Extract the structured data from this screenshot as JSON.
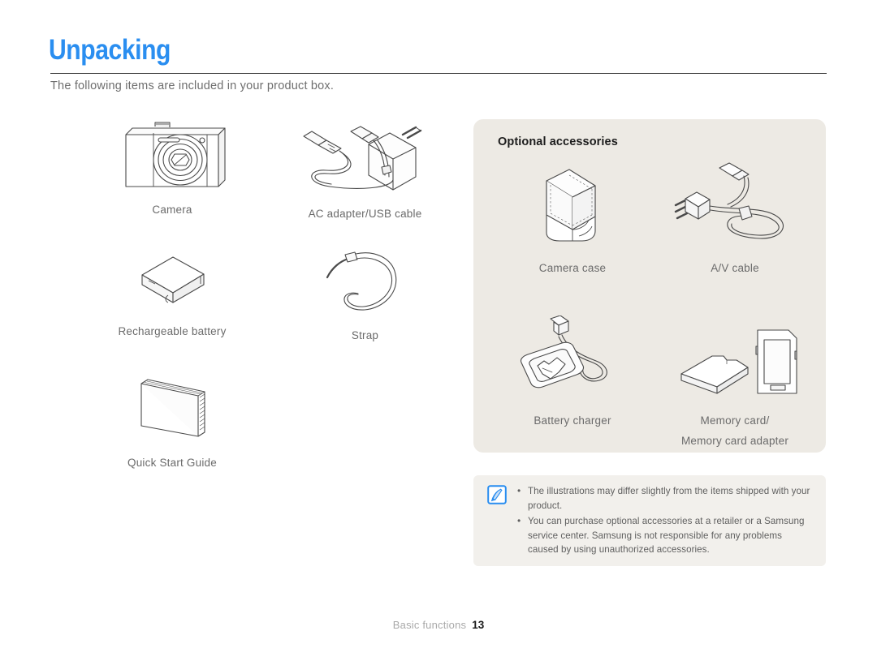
{
  "header": {
    "title": "Unpacking",
    "intro": "The following items are included in your product box.",
    "title_color": "#2a8ef0"
  },
  "included_items": [
    {
      "id": "camera",
      "caption": "Camera",
      "icon": "camera-illustration"
    },
    {
      "id": "ac-adapter",
      "caption": "AC adapter/USB cable",
      "icon": "ac-adapter-usb-cable-illustration"
    },
    {
      "id": "battery",
      "caption": "Rechargeable battery",
      "icon": "rechargeable-battery-illustration"
    },
    {
      "id": "strap",
      "caption": "Strap",
      "icon": "strap-illustration"
    },
    {
      "id": "quick-guide",
      "caption": "Quick Start Guide",
      "icon": "quick-start-guide-illustration"
    }
  ],
  "optional": {
    "title": "Optional accessories",
    "background": "#edeae4",
    "items": [
      {
        "id": "camera-case",
        "caption": "Camera case",
        "caption2": "",
        "icon": "camera-case-illustration"
      },
      {
        "id": "av-cable",
        "caption": "A/V cable",
        "caption2": "",
        "icon": "av-cable-illustration"
      },
      {
        "id": "battery-chg",
        "caption": "Battery charger",
        "caption2": "",
        "icon": "battery-charger-illustration"
      },
      {
        "id": "memory-card",
        "caption": "Memory card/",
        "caption2": "Memory card adapter",
        "icon": "memory-card-illustration"
      }
    ]
  },
  "note": {
    "icon": "note-pen-icon",
    "lines": [
      "The illustrations may differ slightly from the items shipped with your product.",
      "You can purchase optional accessories at a retailer or a Samsung service center. Samsung is not responsible for any problems caused by using unauthorized accessories."
    ]
  },
  "footer": {
    "section": "Basic functions",
    "page": "13"
  }
}
